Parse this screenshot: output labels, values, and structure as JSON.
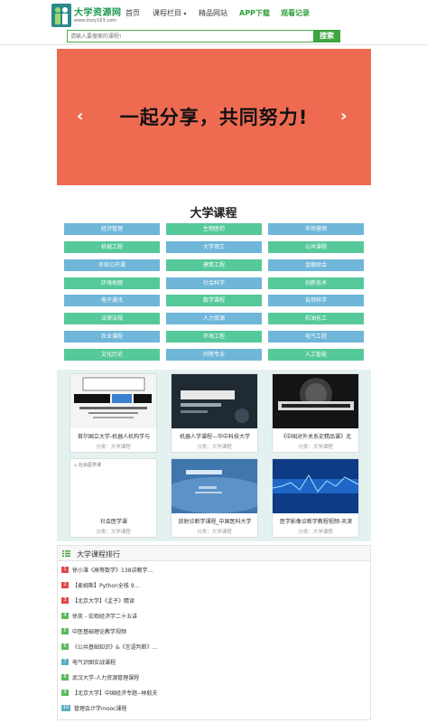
{
  "header": {
    "logo_name": "大学资源网",
    "logo_url": "www.dxzy163.com",
    "nav": [
      "首页",
      "课程栏目",
      "精品网站",
      "APP下载",
      "观看记录"
    ]
  },
  "search": {
    "placeholder": "请输入要搜索的课程!",
    "button_label": "搜索"
  },
  "banner": {
    "text": "一起分享，共同努力!",
    "prev_label": "‹",
    "next_label": "›"
  },
  "courses": {
    "title": "大学课程",
    "categories": [
      "经济管理",
      "生物医药",
      "市场营销",
      "机械工程",
      "大学理工",
      "公共课程",
      "名校公开课",
      "建筑工程",
      "金融财会",
      "环境地理",
      "社会科学",
      "创新技术",
      "电子通讯",
      "数学课程",
      "自然科学",
      "法律法规",
      "人力资源",
      "石油化工",
      "农业课程",
      "环境工程",
      "电气工程",
      "文化历史",
      "同等专业",
      "人工智能"
    ]
  },
  "cards": [
    {
      "title": "首尔国立大学-机器人机构学与",
      "category": "分类：大学课程",
      "img_text": "Robot Mechanism and Control"
    },
    {
      "title": "机器人学课程—华中科技大学",
      "category": "分类：大学课程",
      "img_text": "机器人学"
    },
    {
      "title": "《中国对外关系史精品课》北",
      "category": "分类：大学课程",
      "img_text": "《中国对外关系史》"
    },
    {
      "title": "社会医学课",
      "category": "分类：大学课程",
      "img_text": "社会医学课"
    },
    {
      "title": "放射诊断学课程_中国医科大学",
      "category": "分类：大学课程",
      "img_text": "放射诊断学"
    },
    {
      "title": "医学影像诊断学教程视频-天津",
      "category": "分类：大学课程",
      "img_text": ""
    }
  ],
  "ranking": {
    "title": "大学课程排行",
    "items": [
      {
        "num": "1",
        "text": "徐小湛《高等数学》138讲教学..."
      },
      {
        "num": "2",
        "text": "【麦姆斯】Python全栈 9..."
      },
      {
        "num": "3",
        "text": "【北京大学】《孟子》精读"
      },
      {
        "num": "4",
        "text": "徐奕 - 宏观经济学二十五讲"
      },
      {
        "num": "5",
        "text": "中医基础理论教学视频"
      },
      {
        "num": "6",
        "text": "《公共基础知识》&《言语判断》..."
      },
      {
        "num": "7",
        "text": "电气识图实战课程"
      },
      {
        "num": "8",
        "text": "武汉大学-人力资源管理课程"
      },
      {
        "num": "9",
        "text": "【北京大学】中国经济专题--林毅夫"
      },
      {
        "num": "10",
        "text": "管理会计学mooc课程"
      }
    ]
  },
  "colors": {
    "brand_green": "#3fa53f",
    "banner_bg": "#ee6b52",
    "category_blue": "#6fb6d9",
    "category_green": "#56c99a",
    "rank_red": "#e0474c",
    "rank_green": "#5cb85c",
    "rank_teal": "#5bb0c0"
  }
}
